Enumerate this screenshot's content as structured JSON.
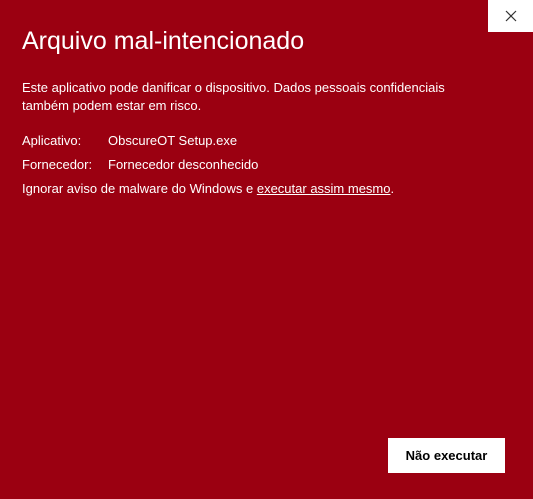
{
  "dialog": {
    "title": "Arquivo mal-intencionado",
    "description": "Este aplicativo pode danificar o dispositivo. Dados pessoais confidenciais também podem estar em risco.",
    "app_label": "Aplicativo:",
    "app_value": "ObscureOT Setup.exe",
    "vendor_label": "Fornecedor:",
    "vendor_value": "Fornecedor desconhecido",
    "ignore_text": "Ignorar aviso de malware do Windows e ",
    "ignore_link": "executar assim mesmo",
    "ignore_end": ".",
    "button_label": "Não executar",
    "close_icon": "close-icon"
  },
  "colors": {
    "background": "#9b0011",
    "text": "#ffffff",
    "button_bg": "#ffffff",
    "button_text": "#000000"
  }
}
